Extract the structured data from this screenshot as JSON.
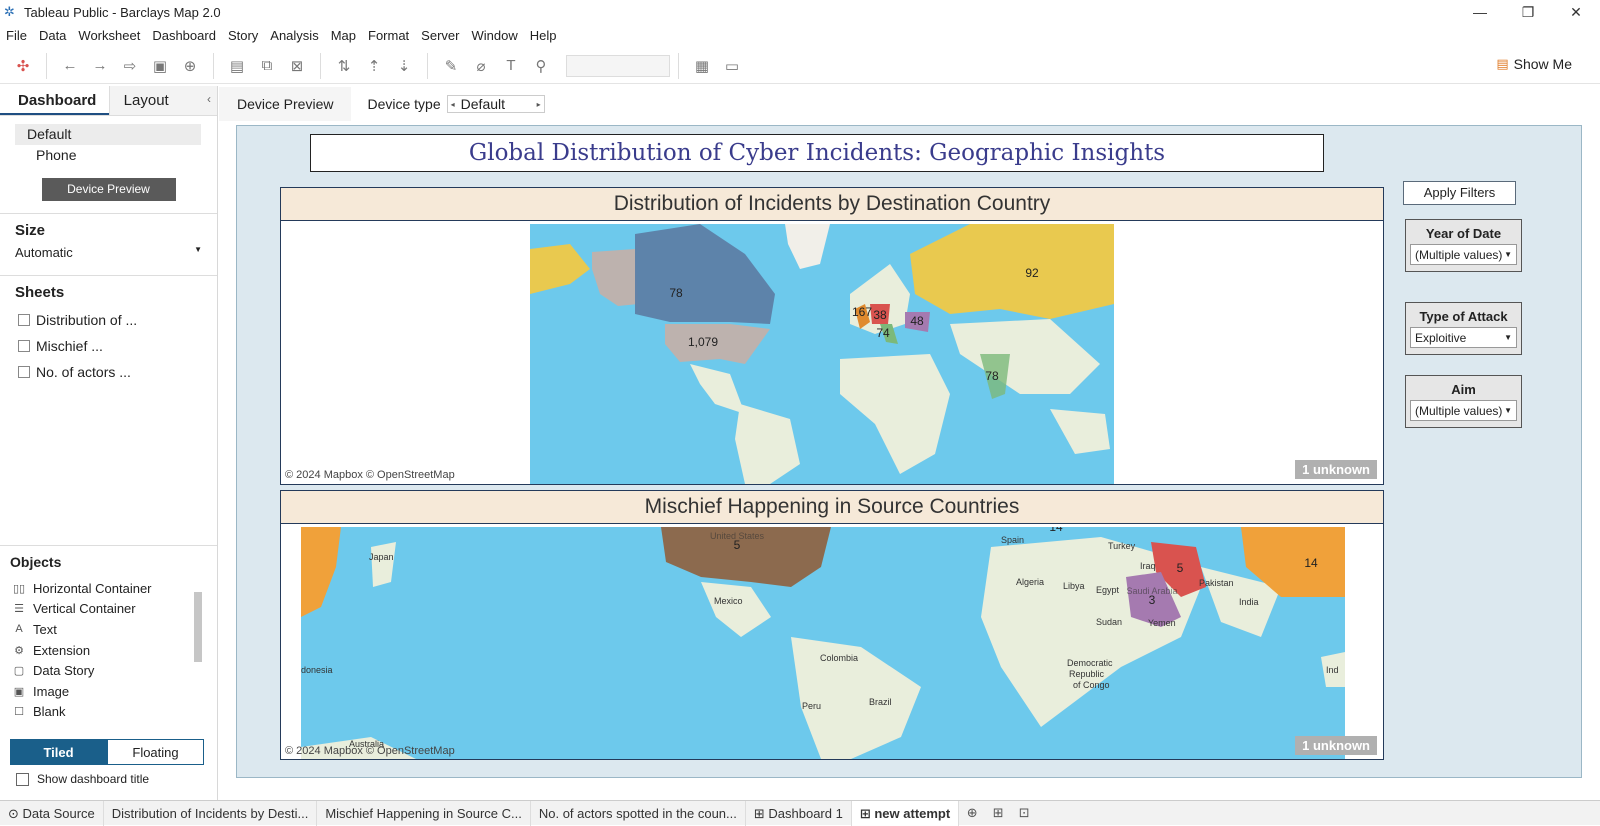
{
  "window": {
    "title": "Tableau Public - Barclays Map 2.0",
    "minimize": "—",
    "restore": "❐",
    "close": "✕"
  },
  "menu": [
    "File",
    "Data",
    "Worksheet",
    "Dashboard",
    "Story",
    "Analysis",
    "Map",
    "Format",
    "Server",
    "Window",
    "Help"
  ],
  "toolbar": {
    "show_me": "Show Me"
  },
  "left_panel": {
    "tab_dashboard": "Dashboard",
    "tab_layout": "Layout",
    "devices": [
      "Default",
      "Phone"
    ],
    "device_preview_button": "Device Preview",
    "size_title": "Size",
    "size_value": "Automatic",
    "sheets_title": "Sheets",
    "sheets": [
      "Distribution of ...",
      "Mischief ...",
      "No. of actors ..."
    ],
    "objects_title": "Objects",
    "objects": [
      "Horizontal Container",
      "Vertical Container",
      "Text",
      "Extension",
      "Data Story",
      "Image",
      "Blank"
    ],
    "tiled": "Tiled",
    "floating": "Floating",
    "show_title": "Show dashboard title"
  },
  "device_bar": {
    "tab": "Device Preview",
    "type_label": "Device type",
    "type_value": "Default"
  },
  "dashboard": {
    "title": "Global Distribution of Cyber Incidents: Geographic Insights",
    "sheet1_title": "Distribution of Incidents by Destination Country",
    "sheet2_title": "Mischief Happening in Source Countries",
    "attribution": "© 2024 Mapbox © OpenStreetMap",
    "unknown_badge": "1 unknown",
    "apply_filters": "Apply Filters",
    "filters": [
      {
        "title": "Year of Date",
        "value": "(Multiple values)"
      },
      {
        "title": "Type of Attack",
        "value": "Exploitive"
      },
      {
        "title": "Aim",
        "value": "(Multiple values)"
      }
    ],
    "map1_labels": {
      "canada": "78",
      "usa": "1,079",
      "russia": "92",
      "uk": "167",
      "de": "38",
      "it": "74",
      "ua": "48",
      "india": "78"
    },
    "map2_labels": {
      "usa": "5",
      "iran": "5",
      "saudi": "3",
      "china": "14",
      "italy": "14"
    },
    "map2_places": {
      "japan": "Japan",
      "mexico": "Mexico",
      "colombia": "Colombia",
      "peru": "Peru",
      "brazil": "Brazil",
      "spain": "Spain",
      "turkey": "Turkey",
      "iraq": "Iraq",
      "algeria": "Algeria",
      "libya": "Libya",
      "egypt": "Egypt",
      "sudan": "Sudan",
      "yemen": "Yemen",
      "pakistan": "Pakistan",
      "india": "India",
      "drc1": "Democratic",
      "drc2": "Republic",
      "drc3": "of Congo",
      "australia": "Australia",
      "indonesia": "donesia",
      "us_faint": "United States",
      "saudi_faint": "Saudi Arabia",
      "ind_right": "Ind"
    }
  },
  "tabs": [
    "Data Source",
    "Distribution of Incidents by Desti...",
    "Mischief Happening in Source C...",
    "No. of actors spotted in the coun...",
    "Dashboard 1",
    "new attempt"
  ],
  "colors": {
    "accent": "#1a5f8a",
    "ocean": "#6dc9ec",
    "land": "#e9eedc",
    "title_text": "#3a3c8c",
    "header_bg": "#f6e9d8"
  }
}
